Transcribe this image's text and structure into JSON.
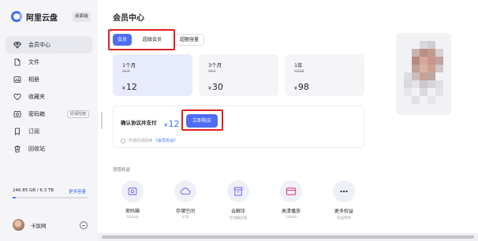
{
  "app": {
    "name": "阿里云盘",
    "desktop_label": "桌面端"
  },
  "sidebar": {
    "items": [
      {
        "label": "会员中心",
        "icon": "diamond-icon",
        "active": true
      },
      {
        "label": "文件",
        "icon": "file-icon"
      },
      {
        "label": "相册",
        "icon": "photo-icon"
      },
      {
        "label": "收藏夹",
        "icon": "heart-icon"
      },
      {
        "label": "密码箱",
        "icon": "safe-icon",
        "badge": "原保险箱"
      },
      {
        "label": "订阅",
        "icon": "bookmark-icon"
      },
      {
        "label": "回收站",
        "icon": "trash-icon"
      }
    ],
    "storage": {
      "text": "246.85 GB / 6.3 TB",
      "used_fraction": 0.038,
      "more_label": "更多容量"
    },
    "user": {
      "name": "卡饭网"
    }
  },
  "main": {
    "title": "会员中心",
    "tabs": [
      {
        "label": "会员",
        "selected": true
      },
      {
        "label": "超级会员"
      },
      {
        "label": "超额容量"
      }
    ],
    "plans": [
      {
        "name": "1个月",
        "original_price": "¥15",
        "currency": "¥",
        "price": "12",
        "selected": true
      },
      {
        "name": "3个月",
        "original_price": "¥57",
        "currency": "¥",
        "price": "30"
      },
      {
        "name": "1年",
        "original_price": "¥228",
        "currency": "¥",
        "price": "98"
      }
    ],
    "payment": {
      "label": "确认协议并支付",
      "currency": "¥",
      "amount": "12",
      "button_label": "立即购买",
      "agreement_text": "开通前请阅读",
      "agreement_link": "《会员协议》"
    },
    "rights_title": "增值权益",
    "benefits": [
      {
        "label": "密码箱",
        "sub": "500GB",
        "icon": "safe-icon"
      },
      {
        "label": "存储空间",
        "sub": "6TB",
        "icon": "cloud-icon"
      },
      {
        "label": "云解压",
        "sub": "在线解压缩",
        "icon": "archive-icon"
      },
      {
        "label": "高清播放",
        "sub": "1080P",
        "icon": "video-icon"
      },
      {
        "label": "更多权益",
        "sub": "权益特供",
        "icon": "more-icon"
      }
    ]
  },
  "colors": {
    "accent": "#4f6df3",
    "link": "#3a6ff0",
    "highlight": "#e02020",
    "sidebar_bg": "#f5f5f7",
    "selected_plan_bg": "#e8ebfd"
  }
}
